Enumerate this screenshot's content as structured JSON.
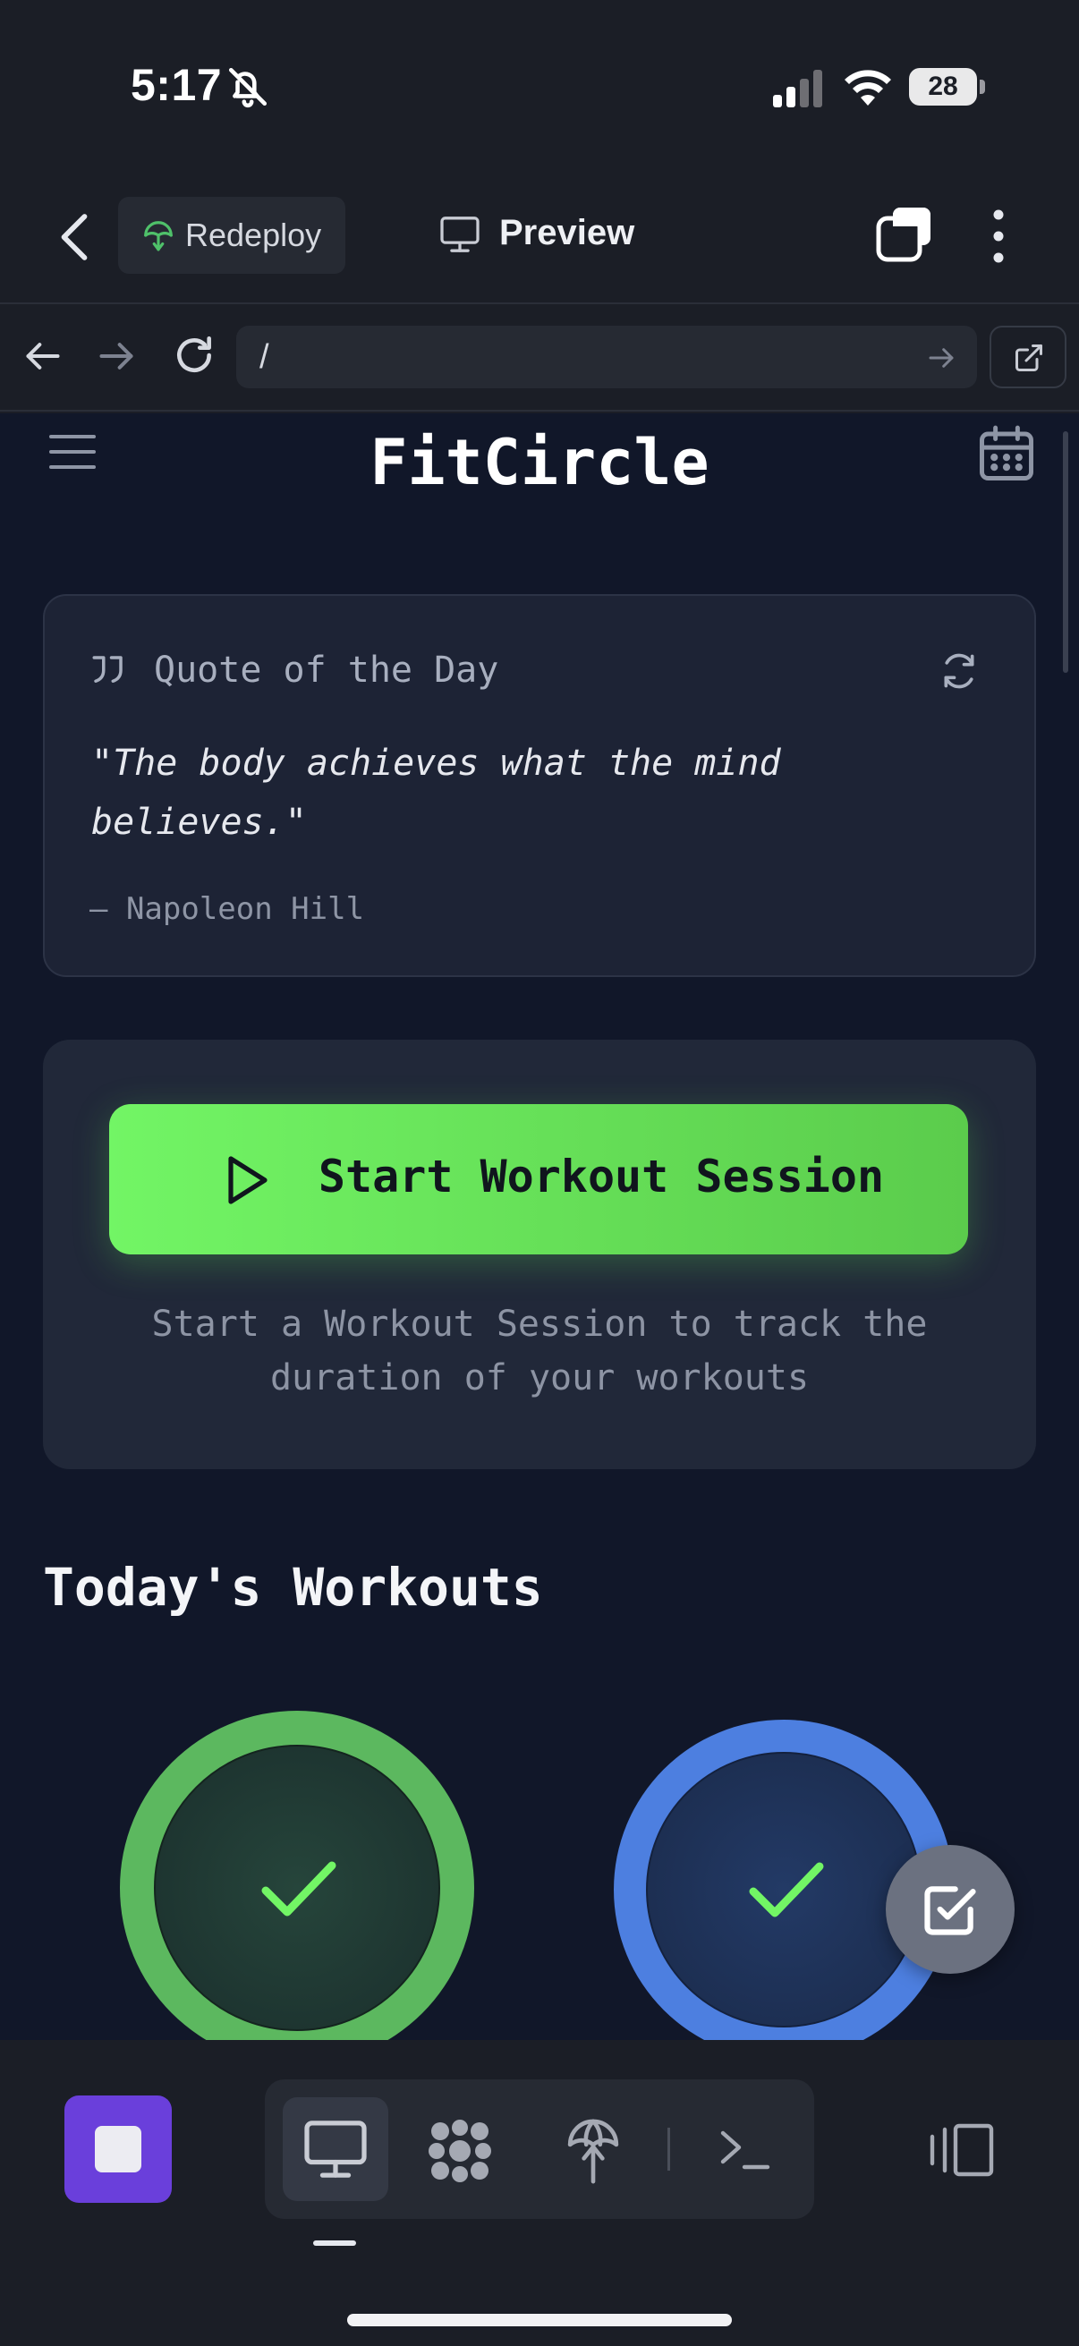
{
  "status_bar": {
    "time": "5:17",
    "battery": "28",
    "icons": [
      "bell-slash-icon",
      "signal-icon",
      "wifi-icon",
      "battery-icon"
    ]
  },
  "app_header": {
    "redeploy_label": "Redeploy",
    "preview_label": "Preview",
    "icons": [
      "chevron-left-icon",
      "deploy-icon",
      "monitor-icon",
      "tabs-icon",
      "more-vertical-icon"
    ]
  },
  "url_bar": {
    "url": "/",
    "icons": [
      "arrow-left-icon",
      "arrow-right-icon",
      "reload-icon",
      "go-icon",
      "external-link-icon"
    ]
  },
  "page": {
    "brand": "FitCircle",
    "quote": {
      "title": "Quote of the Day",
      "text": "\"The body achieves what the mind believes.\"",
      "author": "— Napoleon Hill"
    },
    "session": {
      "button_label": "Start Workout Session",
      "description": "Start a Workout Session to track the duration of your workouts"
    },
    "workouts_title": "Today's Workouts",
    "workout_rings": [
      {
        "color": "#5cb85f",
        "status": "completed"
      },
      {
        "color": "#4d7fe0",
        "status": "completed"
      }
    ],
    "icons": [
      "menu-icon",
      "calendar-icon",
      "quote-icon",
      "refresh-icon",
      "play-icon",
      "check-icon",
      "checkbox-icon"
    ]
  },
  "bottom_bar": {
    "icons": [
      "stop-icon",
      "desktop-icon",
      "ai-icon",
      "deploy-icon",
      "shell-icon",
      "panel-icon"
    ]
  },
  "colors": {
    "accent_green": "#72f565",
    "ring_green": "#5cb85f",
    "ring_blue": "#4d7fe0",
    "stop_purple": "#6a3fdb",
    "page_background": "#111729"
  }
}
